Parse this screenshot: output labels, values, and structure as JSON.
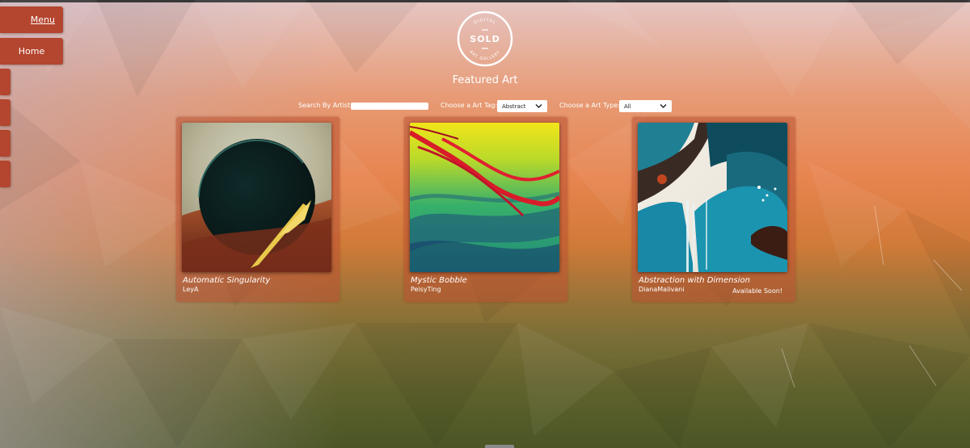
{
  "nav": {
    "menu_label": "Menu",
    "home_label": "Home"
  },
  "logo": {
    "top_text": "DIGITAL",
    "main_text": "SOLD",
    "bottom_text": "ART GALLERY"
  },
  "page_title": "Featured Art",
  "filters": {
    "artist_label": "Search By Artist:",
    "artist_value": "",
    "tag_label": "Choose a Art Tag:",
    "tag_selected": "Abstract",
    "type_label": "Choose a Art Type:",
    "type_selected": "All"
  },
  "artworks": [
    {
      "title": "Automatic Singularity",
      "artist": "LeyA",
      "status": ""
    },
    {
      "title": "Mystic Bobble",
      "artist": "PeisyTing",
      "status": ""
    },
    {
      "title": "Abstraction with Dimension",
      "artist": "DianaMalivani",
      "status": "Available Soon!"
    }
  ],
  "colors": {
    "accent": "#b4452f",
    "card_bg": "#b9503280",
    "text": "#ffffff"
  }
}
